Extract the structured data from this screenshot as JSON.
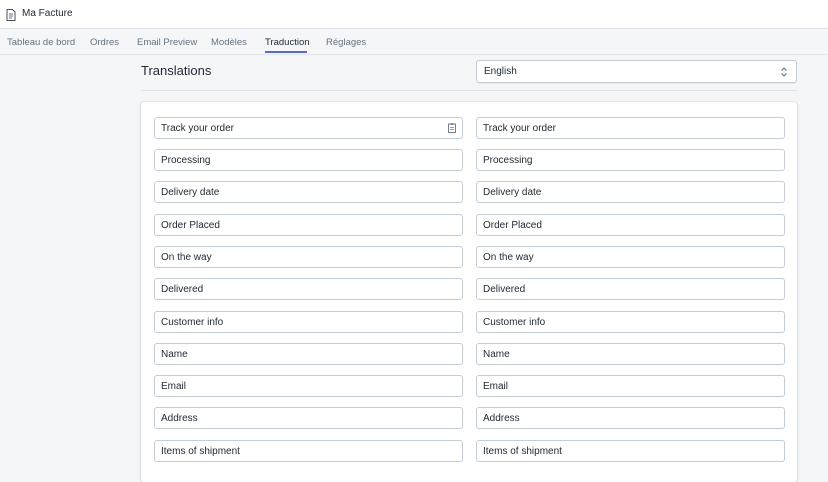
{
  "app": {
    "title": "Ma Facture"
  },
  "nav": {
    "tabs": [
      {
        "label": "Tableau de bord"
      },
      {
        "label": "Ordres"
      },
      {
        "label": "Email Preview"
      },
      {
        "label": "Modèles"
      },
      {
        "label": "Traduction",
        "active": true
      },
      {
        "label": "Réglages"
      }
    ]
  },
  "page": {
    "title": "Translations"
  },
  "language_select": {
    "value": "English"
  },
  "translations": [
    {
      "source": "Track your order",
      "target": "Track your order"
    },
    {
      "source": "Processing",
      "target": "Processing"
    },
    {
      "source": "Delivery date",
      "target": "Delivery date"
    },
    {
      "source": "Order Placed",
      "target": "Order Placed"
    },
    {
      "source": "On the way",
      "target": "On the way"
    },
    {
      "source": "Delivered",
      "target": "Delivered"
    },
    {
      "source": "Customer info",
      "target": "Customer info"
    },
    {
      "source": "Name",
      "target": "Name"
    },
    {
      "source": "Email",
      "target": "Email"
    },
    {
      "source": "Address",
      "target": "Address"
    },
    {
      "source": "Items of shipment",
      "target": "Items of shipment"
    }
  ],
  "icons": {
    "app": "invoice-icon",
    "select": "select-arrows-icon",
    "field": "clipboard-icon"
  },
  "colors": {
    "accent": "#5c6ac4",
    "background": "#f4f6f8",
    "border": "#c4cdd5"
  }
}
